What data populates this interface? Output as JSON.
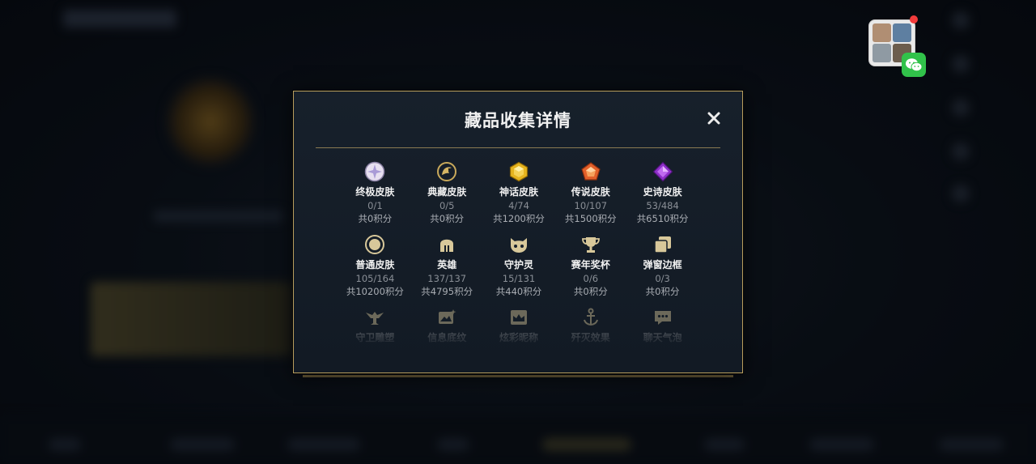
{
  "dialog": {
    "title": "藏品收集详情",
    "close_glyph": "✕"
  },
  "collection_rows": [
    [
      {
        "name": "终极皮肤",
        "progress": "0/1",
        "score": "共0积分",
        "icon": "ultimate-skin-icon"
      },
      {
        "name": "典藏皮肤",
        "progress": "0/5",
        "score": "共0积分",
        "icon": "collector-skin-icon"
      },
      {
        "name": "神话皮肤",
        "progress": "4/74",
        "score": "共1200积分",
        "icon": "mythic-skin-icon"
      },
      {
        "name": "传说皮肤",
        "progress": "10/107",
        "score": "共1500积分",
        "icon": "legendary-skin-icon"
      },
      {
        "name": "史诗皮肤",
        "progress": "53/484",
        "score": "共6510积分",
        "icon": "epic-skin-icon"
      }
    ],
    [
      {
        "name": "普通皮肤",
        "progress": "105/164",
        "score": "共10200积分",
        "icon": "normal-skin-icon"
      },
      {
        "name": "英雄",
        "progress": "137/137",
        "score": "共4795积分",
        "icon": "hero-helmet-icon"
      },
      {
        "name": "守护灵",
        "progress": "15/131",
        "score": "共440积分",
        "icon": "guardian-spirit-icon"
      },
      {
        "name": "赛年奖杯",
        "progress": "0/6",
        "score": "共0积分",
        "icon": "trophy-icon"
      },
      {
        "name": "弹窗边框",
        "progress": "0/3",
        "score": "共0积分",
        "icon": "popup-frame-icon"
      }
    ],
    [
      {
        "name": "守卫雕塑",
        "icon": "statue-icon"
      },
      {
        "name": "信息底纹",
        "icon": "info-background-icon"
      },
      {
        "name": "炫彩昵称",
        "icon": "colorful-nickname-icon"
      },
      {
        "name": "歼灭效果",
        "icon": "elimination-effect-icon"
      },
      {
        "name": "聊天气泡",
        "icon": "chat-bubble-icon"
      }
    ]
  ],
  "colors": {
    "gold_border": "#b89e5e",
    "dialog_bg": "#17202b",
    "title_text": "#f1f1f1",
    "progress_text": "#8a8f96"
  }
}
